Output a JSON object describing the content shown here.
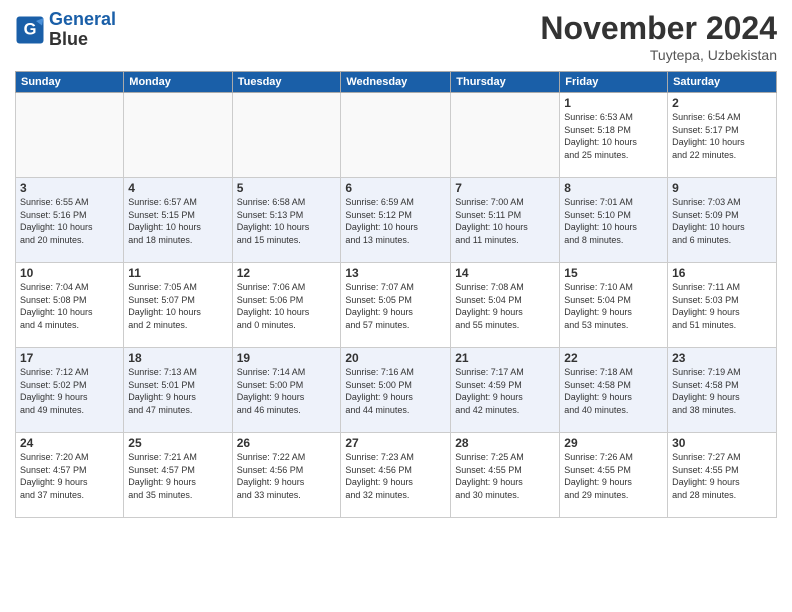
{
  "header": {
    "logo_line1": "General",
    "logo_line2": "Blue",
    "month": "November 2024",
    "location": "Tuytepa, Uzbekistan"
  },
  "weekdays": [
    "Sunday",
    "Monday",
    "Tuesday",
    "Wednesday",
    "Thursday",
    "Friday",
    "Saturday"
  ],
  "weeks": [
    [
      {
        "day": "",
        "info": ""
      },
      {
        "day": "",
        "info": ""
      },
      {
        "day": "",
        "info": ""
      },
      {
        "day": "",
        "info": ""
      },
      {
        "day": "",
        "info": ""
      },
      {
        "day": "1",
        "info": "Sunrise: 6:53 AM\nSunset: 5:18 PM\nDaylight: 10 hours\nand 25 minutes."
      },
      {
        "day": "2",
        "info": "Sunrise: 6:54 AM\nSunset: 5:17 PM\nDaylight: 10 hours\nand 22 minutes."
      }
    ],
    [
      {
        "day": "3",
        "info": "Sunrise: 6:55 AM\nSunset: 5:16 PM\nDaylight: 10 hours\nand 20 minutes."
      },
      {
        "day": "4",
        "info": "Sunrise: 6:57 AM\nSunset: 5:15 PM\nDaylight: 10 hours\nand 18 minutes."
      },
      {
        "day": "5",
        "info": "Sunrise: 6:58 AM\nSunset: 5:13 PM\nDaylight: 10 hours\nand 15 minutes."
      },
      {
        "day": "6",
        "info": "Sunrise: 6:59 AM\nSunset: 5:12 PM\nDaylight: 10 hours\nand 13 minutes."
      },
      {
        "day": "7",
        "info": "Sunrise: 7:00 AM\nSunset: 5:11 PM\nDaylight: 10 hours\nand 11 minutes."
      },
      {
        "day": "8",
        "info": "Sunrise: 7:01 AM\nSunset: 5:10 PM\nDaylight: 10 hours\nand 8 minutes."
      },
      {
        "day": "9",
        "info": "Sunrise: 7:03 AM\nSunset: 5:09 PM\nDaylight: 10 hours\nand 6 minutes."
      }
    ],
    [
      {
        "day": "10",
        "info": "Sunrise: 7:04 AM\nSunset: 5:08 PM\nDaylight: 10 hours\nand 4 minutes."
      },
      {
        "day": "11",
        "info": "Sunrise: 7:05 AM\nSunset: 5:07 PM\nDaylight: 10 hours\nand 2 minutes."
      },
      {
        "day": "12",
        "info": "Sunrise: 7:06 AM\nSunset: 5:06 PM\nDaylight: 10 hours\nand 0 minutes."
      },
      {
        "day": "13",
        "info": "Sunrise: 7:07 AM\nSunset: 5:05 PM\nDaylight: 9 hours\nand 57 minutes."
      },
      {
        "day": "14",
        "info": "Sunrise: 7:08 AM\nSunset: 5:04 PM\nDaylight: 9 hours\nand 55 minutes."
      },
      {
        "day": "15",
        "info": "Sunrise: 7:10 AM\nSunset: 5:04 PM\nDaylight: 9 hours\nand 53 minutes."
      },
      {
        "day": "16",
        "info": "Sunrise: 7:11 AM\nSunset: 5:03 PM\nDaylight: 9 hours\nand 51 minutes."
      }
    ],
    [
      {
        "day": "17",
        "info": "Sunrise: 7:12 AM\nSunset: 5:02 PM\nDaylight: 9 hours\nand 49 minutes."
      },
      {
        "day": "18",
        "info": "Sunrise: 7:13 AM\nSunset: 5:01 PM\nDaylight: 9 hours\nand 47 minutes."
      },
      {
        "day": "19",
        "info": "Sunrise: 7:14 AM\nSunset: 5:00 PM\nDaylight: 9 hours\nand 46 minutes."
      },
      {
        "day": "20",
        "info": "Sunrise: 7:16 AM\nSunset: 5:00 PM\nDaylight: 9 hours\nand 44 minutes."
      },
      {
        "day": "21",
        "info": "Sunrise: 7:17 AM\nSunset: 4:59 PM\nDaylight: 9 hours\nand 42 minutes."
      },
      {
        "day": "22",
        "info": "Sunrise: 7:18 AM\nSunset: 4:58 PM\nDaylight: 9 hours\nand 40 minutes."
      },
      {
        "day": "23",
        "info": "Sunrise: 7:19 AM\nSunset: 4:58 PM\nDaylight: 9 hours\nand 38 minutes."
      }
    ],
    [
      {
        "day": "24",
        "info": "Sunrise: 7:20 AM\nSunset: 4:57 PM\nDaylight: 9 hours\nand 37 minutes."
      },
      {
        "day": "25",
        "info": "Sunrise: 7:21 AM\nSunset: 4:57 PM\nDaylight: 9 hours\nand 35 minutes."
      },
      {
        "day": "26",
        "info": "Sunrise: 7:22 AM\nSunset: 4:56 PM\nDaylight: 9 hours\nand 33 minutes."
      },
      {
        "day": "27",
        "info": "Sunrise: 7:23 AM\nSunset: 4:56 PM\nDaylight: 9 hours\nand 32 minutes."
      },
      {
        "day": "28",
        "info": "Sunrise: 7:25 AM\nSunset: 4:55 PM\nDaylight: 9 hours\nand 30 minutes."
      },
      {
        "day": "29",
        "info": "Sunrise: 7:26 AM\nSunset: 4:55 PM\nDaylight: 9 hours\nand 29 minutes."
      },
      {
        "day": "30",
        "info": "Sunrise: 7:27 AM\nSunset: 4:55 PM\nDaylight: 9 hours\nand 28 minutes."
      }
    ]
  ]
}
